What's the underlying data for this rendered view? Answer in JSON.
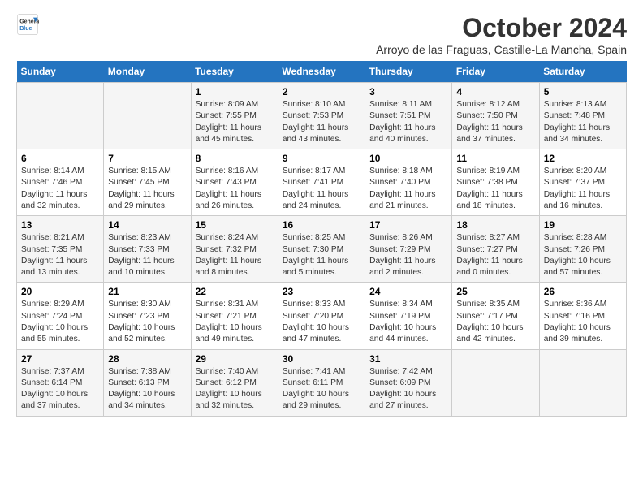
{
  "header": {
    "logo_line1": "General",
    "logo_line2": "Blue",
    "month_title": "October 2024",
    "subtitle": "Arroyo de las Fraguas, Castille-La Mancha, Spain"
  },
  "days_of_week": [
    "Sunday",
    "Monday",
    "Tuesday",
    "Wednesday",
    "Thursday",
    "Friday",
    "Saturday"
  ],
  "weeks": [
    [
      {
        "day": "",
        "info": ""
      },
      {
        "day": "",
        "info": ""
      },
      {
        "day": "1",
        "info": "Sunrise: 8:09 AM\nSunset: 7:55 PM\nDaylight: 11 hours and 45 minutes."
      },
      {
        "day": "2",
        "info": "Sunrise: 8:10 AM\nSunset: 7:53 PM\nDaylight: 11 hours and 43 minutes."
      },
      {
        "day": "3",
        "info": "Sunrise: 8:11 AM\nSunset: 7:51 PM\nDaylight: 11 hours and 40 minutes."
      },
      {
        "day": "4",
        "info": "Sunrise: 8:12 AM\nSunset: 7:50 PM\nDaylight: 11 hours and 37 minutes."
      },
      {
        "day": "5",
        "info": "Sunrise: 8:13 AM\nSunset: 7:48 PM\nDaylight: 11 hours and 34 minutes."
      }
    ],
    [
      {
        "day": "6",
        "info": "Sunrise: 8:14 AM\nSunset: 7:46 PM\nDaylight: 11 hours and 32 minutes."
      },
      {
        "day": "7",
        "info": "Sunrise: 8:15 AM\nSunset: 7:45 PM\nDaylight: 11 hours and 29 minutes."
      },
      {
        "day": "8",
        "info": "Sunrise: 8:16 AM\nSunset: 7:43 PM\nDaylight: 11 hours and 26 minutes."
      },
      {
        "day": "9",
        "info": "Sunrise: 8:17 AM\nSunset: 7:41 PM\nDaylight: 11 hours and 24 minutes."
      },
      {
        "day": "10",
        "info": "Sunrise: 8:18 AM\nSunset: 7:40 PM\nDaylight: 11 hours and 21 minutes."
      },
      {
        "day": "11",
        "info": "Sunrise: 8:19 AM\nSunset: 7:38 PM\nDaylight: 11 hours and 18 minutes."
      },
      {
        "day": "12",
        "info": "Sunrise: 8:20 AM\nSunset: 7:37 PM\nDaylight: 11 hours and 16 minutes."
      }
    ],
    [
      {
        "day": "13",
        "info": "Sunrise: 8:21 AM\nSunset: 7:35 PM\nDaylight: 11 hours and 13 minutes."
      },
      {
        "day": "14",
        "info": "Sunrise: 8:23 AM\nSunset: 7:33 PM\nDaylight: 11 hours and 10 minutes."
      },
      {
        "day": "15",
        "info": "Sunrise: 8:24 AM\nSunset: 7:32 PM\nDaylight: 11 hours and 8 minutes."
      },
      {
        "day": "16",
        "info": "Sunrise: 8:25 AM\nSunset: 7:30 PM\nDaylight: 11 hours and 5 minutes."
      },
      {
        "day": "17",
        "info": "Sunrise: 8:26 AM\nSunset: 7:29 PM\nDaylight: 11 hours and 2 minutes."
      },
      {
        "day": "18",
        "info": "Sunrise: 8:27 AM\nSunset: 7:27 PM\nDaylight: 11 hours and 0 minutes."
      },
      {
        "day": "19",
        "info": "Sunrise: 8:28 AM\nSunset: 7:26 PM\nDaylight: 10 hours and 57 minutes."
      }
    ],
    [
      {
        "day": "20",
        "info": "Sunrise: 8:29 AM\nSunset: 7:24 PM\nDaylight: 10 hours and 55 minutes."
      },
      {
        "day": "21",
        "info": "Sunrise: 8:30 AM\nSunset: 7:23 PM\nDaylight: 10 hours and 52 minutes."
      },
      {
        "day": "22",
        "info": "Sunrise: 8:31 AM\nSunset: 7:21 PM\nDaylight: 10 hours and 49 minutes."
      },
      {
        "day": "23",
        "info": "Sunrise: 8:33 AM\nSunset: 7:20 PM\nDaylight: 10 hours and 47 minutes."
      },
      {
        "day": "24",
        "info": "Sunrise: 8:34 AM\nSunset: 7:19 PM\nDaylight: 10 hours and 44 minutes."
      },
      {
        "day": "25",
        "info": "Sunrise: 8:35 AM\nSunset: 7:17 PM\nDaylight: 10 hours and 42 minutes."
      },
      {
        "day": "26",
        "info": "Sunrise: 8:36 AM\nSunset: 7:16 PM\nDaylight: 10 hours and 39 minutes."
      }
    ],
    [
      {
        "day": "27",
        "info": "Sunrise: 7:37 AM\nSunset: 6:14 PM\nDaylight: 10 hours and 37 minutes."
      },
      {
        "day": "28",
        "info": "Sunrise: 7:38 AM\nSunset: 6:13 PM\nDaylight: 10 hours and 34 minutes."
      },
      {
        "day": "29",
        "info": "Sunrise: 7:40 AM\nSunset: 6:12 PM\nDaylight: 10 hours and 32 minutes."
      },
      {
        "day": "30",
        "info": "Sunrise: 7:41 AM\nSunset: 6:11 PM\nDaylight: 10 hours and 29 minutes."
      },
      {
        "day": "31",
        "info": "Sunrise: 7:42 AM\nSunset: 6:09 PM\nDaylight: 10 hours and 27 minutes."
      },
      {
        "day": "",
        "info": ""
      },
      {
        "day": "",
        "info": ""
      }
    ]
  ]
}
